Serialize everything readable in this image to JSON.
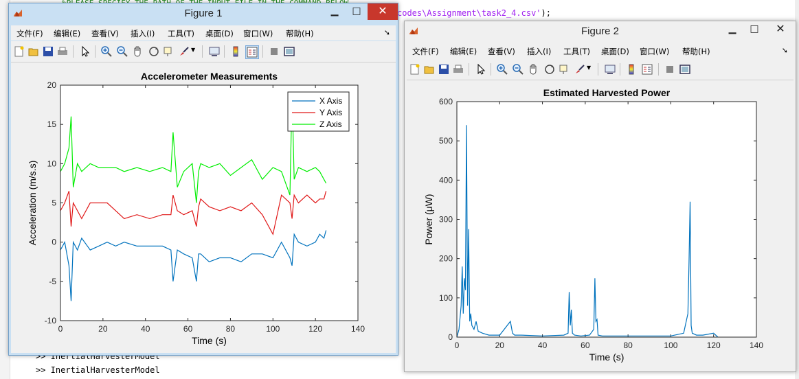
{
  "background": {
    "code_top": "%PLEASE SPECIFY THE PATH OF THE INPUT FILE IN THE COMMAND BELOW",
    "code_right_prefix": "codes\\Assignment\\task2_4.csv'",
    "code_right_suffix": ");",
    "cmd_lines": [
      ">> InertialHarvesterModel",
      ">> InertialHarvesterModel"
    ]
  },
  "figure1": {
    "title": "Figure 1",
    "menu": [
      "文件(F)",
      "编辑(E)",
      "查看(V)",
      "插入(I)",
      "工具(T)",
      "桌面(D)",
      "窗口(W)",
      "帮助(H)"
    ],
    "chart_data": {
      "type": "line",
      "title": "Accelerometer Measurements",
      "xlabel": "Time (s)",
      "ylabel": "Acceleration (m/s.s)",
      "xlim": [
        0,
        140
      ],
      "ylim": [
        -10,
        20
      ],
      "xticks": [
        0,
        20,
        40,
        60,
        80,
        100,
        120,
        140
      ],
      "yticks": [
        -10,
        -5,
        0,
        5,
        10,
        15,
        20
      ],
      "legend_position": "top-right",
      "series": [
        {
          "name": "X Axis",
          "color": "#0072bd",
          "x": [
            0,
            2,
            4,
            5,
            6,
            8,
            10,
            14,
            18,
            22,
            26,
            30,
            36,
            42,
            48,
            52,
            53,
            55,
            58,
            62,
            64,
            65,
            66,
            70,
            75,
            80,
            85,
            90,
            95,
            100,
            104,
            108,
            109,
            110,
            112,
            116,
            120,
            122,
            124,
            125
          ],
          "y": [
            -1,
            0,
            -3,
            -7.5,
            0,
            -1,
            0.5,
            -1,
            -0.5,
            0,
            -0.5,
            0,
            -0.5,
            -0.5,
            -0.5,
            -1,
            -5,
            -1,
            -1.5,
            -2,
            -5,
            -1.5,
            -1.5,
            -2.5,
            -2,
            -2,
            -2.5,
            -1.5,
            -1.5,
            -2,
            0,
            -2,
            -3,
            1,
            0,
            -0.5,
            0,
            1,
            0.5,
            1.5
          ]
        },
        {
          "name": "Y Axis",
          "color": "#e01818",
          "x": [
            0,
            2,
            4,
            5,
            6,
            8,
            10,
            14,
            18,
            22,
            26,
            30,
            36,
            42,
            48,
            52,
            53,
            55,
            58,
            62,
            64,
            65,
            66,
            70,
            75,
            80,
            85,
            90,
            95,
            100,
            104,
            108,
            109,
            110,
            112,
            116,
            120,
            122,
            124,
            125
          ],
          "y": [
            4,
            5,
            6.5,
            2,
            5,
            4,
            3,
            5,
            5,
            5,
            4,
            3,
            3.5,
            3,
            3.5,
            3.5,
            6,
            4,
            3.5,
            4,
            2,
            4.5,
            5.5,
            4.5,
            4,
            4.5,
            4,
            5,
            3.5,
            1,
            6,
            5,
            3,
            6,
            5,
            6,
            5,
            5.5,
            5.5,
            6.5
          ]
        },
        {
          "name": "Z Axis",
          "color": "#00ee00",
          "x": [
            0,
            2,
            4,
            5,
            6,
            8,
            10,
            14,
            18,
            22,
            26,
            30,
            36,
            42,
            48,
            52,
            53,
            55,
            58,
            62,
            64,
            65,
            66,
            70,
            75,
            80,
            85,
            90,
            95,
            100,
            104,
            108,
            109,
            110,
            112,
            116,
            120,
            122,
            124,
            125
          ],
          "y": [
            9,
            10,
            12,
            16,
            7,
            10,
            9,
            10,
            9.5,
            9.5,
            9.5,
            9,
            9.5,
            9,
            9.5,
            9,
            14,
            7,
            9,
            10,
            5,
            9,
            10,
            9.5,
            10,
            8.5,
            9.5,
            10.5,
            8,
            9.5,
            9,
            6,
            19,
            8,
            9.5,
            9,
            9.5,
            9,
            8,
            7.5
          ]
        }
      ]
    }
  },
  "figure2": {
    "title": "Figure 2",
    "menu": [
      "文件(F)",
      "编辑(E)",
      "查看(V)",
      "插入(I)",
      "工具(T)",
      "桌面(D)",
      "窗口(W)",
      "帮助(H)"
    ],
    "chart_data": {
      "type": "line",
      "title": "Estimated Harvested Power",
      "xlabel": "Time (s)",
      "ylabel": "Power (μW)",
      "xlim": [
        0,
        140
      ],
      "ylim": [
        0,
        600
      ],
      "xticks": [
        0,
        20,
        40,
        60,
        80,
        100,
        120,
        140
      ],
      "yticks": [
        0,
        100,
        200,
        300,
        400,
        500,
        600
      ],
      "series": [
        {
          "color": "#0072bd",
          "x": [
            0,
            1,
            2,
            2.5,
            3,
            3.5,
            4,
            4.5,
            5,
            5.5,
            6,
            6.5,
            7,
            8,
            9,
            10,
            12,
            15,
            20,
            25,
            26,
            27,
            30,
            40,
            50,
            52,
            52.5,
            53,
            53.5,
            54,
            55,
            58,
            62,
            64,
            64.5,
            65,
            65.5,
            66,
            68,
            80,
            100,
            106,
            108,
            108.5,
            109,
            109.5,
            110,
            112,
            115,
            120,
            122
          ],
          "y": [
            0,
            20,
            80,
            180,
            60,
            150,
            120,
            540,
            80,
            275,
            40,
            60,
            30,
            20,
            40,
            15,
            10,
            5,
            5,
            40,
            10,
            5,
            5,
            3,
            5,
            10,
            115,
            30,
            70,
            10,
            5,
            3,
            5,
            20,
            150,
            40,
            45,
            5,
            3,
            3,
            3,
            10,
            60,
            190,
            345,
            30,
            10,
            5,
            5,
            10,
            0
          ]
        }
      ]
    }
  }
}
